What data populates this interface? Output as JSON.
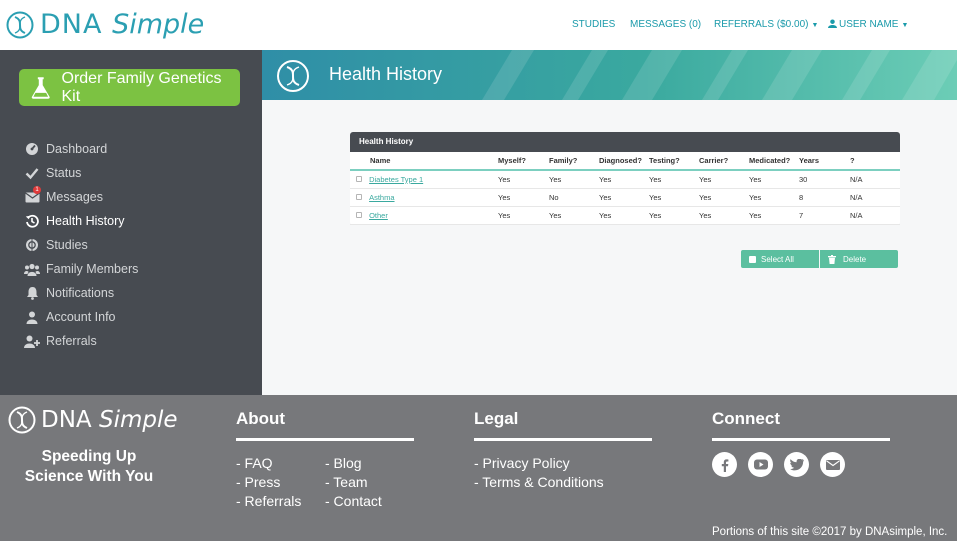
{
  "brand": {
    "logo_main": "DNA",
    "logo_light": "Simple",
    "accent": "#2b9fb2"
  },
  "topnav": {
    "studies": "STUDIES",
    "messages": "MESSAGES (0)",
    "referrals": "REFERRALS ($0.00)",
    "user": "USER NAME"
  },
  "sidebar": {
    "order_button": "Order Family Genetics Kit",
    "messages_badge": "1",
    "items": [
      {
        "label": "Dashboard",
        "icon": "dashboard-icon"
      },
      {
        "label": "Status",
        "icon": "check-icon"
      },
      {
        "label": "Messages",
        "icon": "envelope-icon"
      },
      {
        "label": "Health History",
        "icon": "history-icon"
      },
      {
        "label": "Studies",
        "icon": "studies-icon"
      },
      {
        "label": "Family Members",
        "icon": "users-icon"
      },
      {
        "label": "Notifications",
        "icon": "bell-icon"
      },
      {
        "label": "Account Info",
        "icon": "user-icon"
      },
      {
        "label": "Referrals",
        "icon": "user-plus-icon"
      }
    ]
  },
  "page": {
    "title": "Health History"
  },
  "table": {
    "title": "Health History",
    "columns": [
      "Name",
      "Myself?",
      "Family?",
      "Diagnosed?",
      "Testing?",
      "Carrier?",
      "Medicated?",
      "Years",
      "?"
    ],
    "rows": [
      [
        "Diabetes Type 1",
        "Yes",
        "Yes",
        "Yes",
        "Yes",
        "Yes",
        "Yes",
        "30",
        "N/A"
      ],
      [
        "Asthma",
        "Yes",
        "No",
        "Yes",
        "Yes",
        "Yes",
        "Yes",
        "8",
        "N/A"
      ],
      [
        "Other",
        "Yes",
        "Yes",
        "Yes",
        "Yes",
        "Yes",
        "Yes",
        "7",
        "N/A"
      ]
    ]
  },
  "actions": {
    "select_all": "Select All",
    "delete": "Delete"
  },
  "footer": {
    "tagline_1": "Speeding Up",
    "tagline_2": "Science With You",
    "about": {
      "heading": "About",
      "links": [
        "- FAQ",
        "- Press",
        "- Referrals",
        "- Blog",
        "- Team",
        "- Contact"
      ]
    },
    "legal": {
      "heading": "Legal",
      "links": [
        "- Privacy Policy",
        "- Terms & Conditions"
      ]
    },
    "connect": {
      "heading": "Connect",
      "icons": [
        "facebook-icon",
        "youtube-icon",
        "twitter-icon",
        "email-icon"
      ]
    },
    "copyright": "Portions of this site ©2017 by DNAsimple, Inc."
  }
}
